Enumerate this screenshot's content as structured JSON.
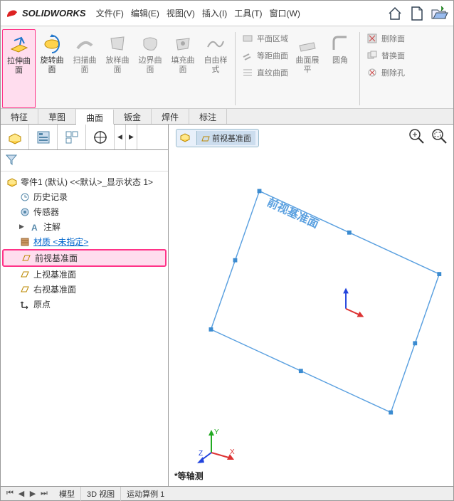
{
  "app": {
    "name": "SOLIDWORKS"
  },
  "menu": {
    "file": "文件(F)",
    "edit": "编辑(E)",
    "view": "视图(V)",
    "insert": "插入(I)",
    "tools": "工具(T)",
    "window": "窗口(W)"
  },
  "ribbon": {
    "extrude_surface": "拉伸曲\n面",
    "revolve_surface": "旋转曲\n面",
    "swept_surface": "扫描曲\n面",
    "loft_surface": "放样曲\n面",
    "boundary_surface": "边界曲\n面",
    "fill_surface": "填充曲\n面",
    "freeform": "自由样\n式",
    "planar_region": "平面区域",
    "offset_surface": "等距曲面",
    "ruled_surface": "直纹曲面",
    "surface_flatten": "曲面展\n平",
    "fillet": "圆角",
    "delete_face": "删除面",
    "replace_face": "替换面",
    "delete_hole": "删除孔"
  },
  "tabs": {
    "features": "特征",
    "sketch": "草图",
    "surfaces": "曲面",
    "sheet_metal": "钣金",
    "weldments": "焊件",
    "annotations": "标注"
  },
  "tree": {
    "root": "零件1 (默认) <<默认>_显示状态 1>",
    "history": "历史记录",
    "sensors": "传感器",
    "annotations": "注解",
    "material": "材质 <未指定>",
    "front_plane": "前视基准面",
    "top_plane": "上视基准面",
    "right_plane": "右视基准面",
    "origin": "原点"
  },
  "breadcrumb": {
    "plane": "前视基准面"
  },
  "viewport": {
    "plane_label": "前视基准面",
    "view_name": "*等轴测"
  },
  "bottom_tabs": {
    "model": "模型",
    "view3d": "3D 视图",
    "motion": "运动算例 1"
  }
}
